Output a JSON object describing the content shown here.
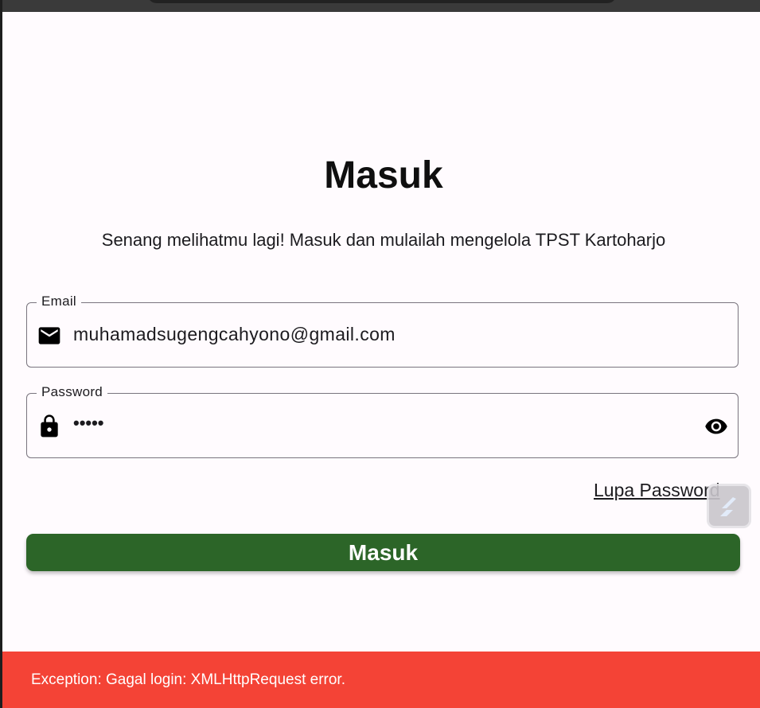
{
  "page": {
    "title": "Masuk",
    "subtitle": "Senang melihatmu lagi! Masuk dan mulailah mengelola TPST Kartoharjo"
  },
  "email_field": {
    "label": "Email",
    "value": "muhamadsugengcahyono@gmail.com",
    "icon": "mail-icon"
  },
  "password_field": {
    "label": "Password",
    "value": "•••••",
    "icon": "lock-icon",
    "toggle_icon": "eye-icon"
  },
  "forgot_link": "Lupa Password",
  "login_button": "Masuk",
  "snackbar": {
    "message": "Exception: Gagal login: XMLHttpRequest error."
  },
  "colors": {
    "background": "#fffbfe",
    "primary_button": "#2c6528",
    "error_snackbar": "#f44336",
    "outline": "#79747e"
  }
}
